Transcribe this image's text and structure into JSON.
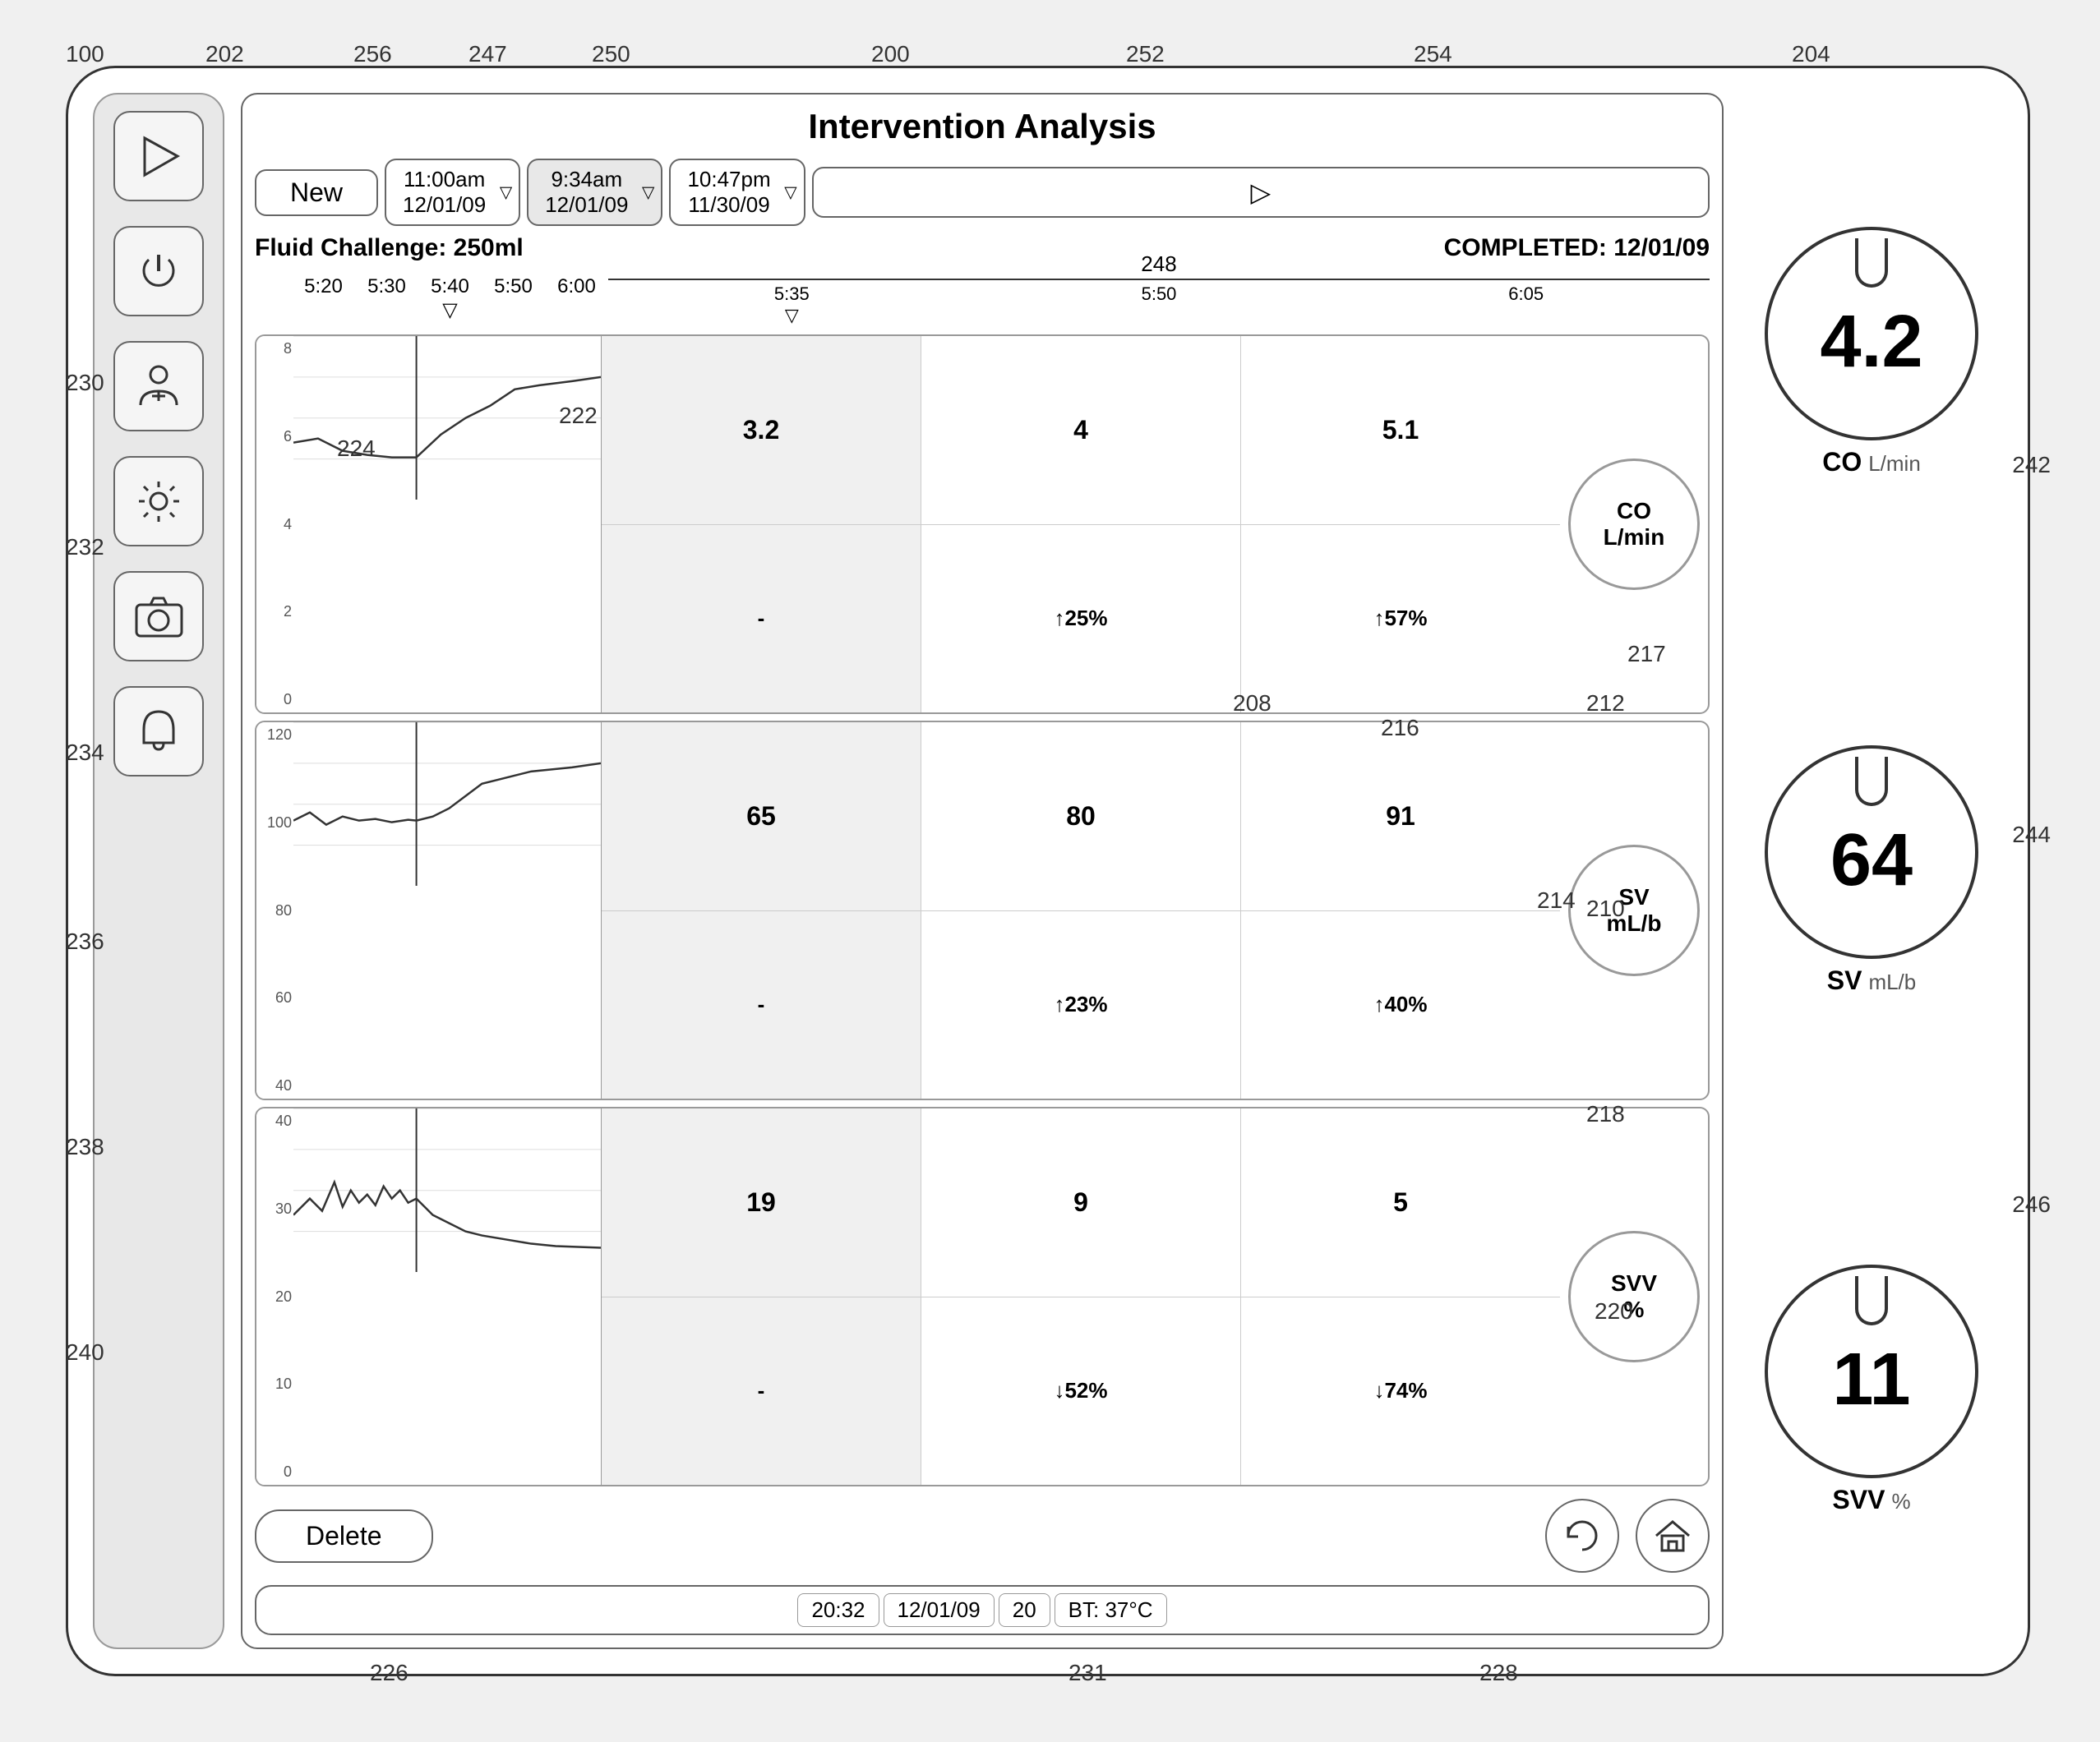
{
  "refs": {
    "r100": "100",
    "r200": "200",
    "r202": "202",
    "r204": "204",
    "r208": "208",
    "r210": "210",
    "r212": "212",
    "r214": "214",
    "r216": "216",
    "r217": "217",
    "r218": "218",
    "r220": "220",
    "r222": "222",
    "r224": "224",
    "r226": "226",
    "r228": "228",
    "r230": "230",
    "r231": "231",
    "r232": "232",
    "r234": "234",
    "r236": "236",
    "r238": "238",
    "r240": "240",
    "r242": "242",
    "r244": "244",
    "r246": "246",
    "r247": "247",
    "r248": "248",
    "r250": "250",
    "r252": "252",
    "r254": "254",
    "r256": "256"
  },
  "title": "Intervention Analysis",
  "tabs": {
    "new_label": "New",
    "tab1_time": "11:00am",
    "tab1_date": "12/01/09",
    "tab2_time": "9:34am",
    "tab2_date": "12/01/09",
    "tab3_time": "10:47pm",
    "tab3_date": "11/30/09"
  },
  "fluid_challenge": "Fluid Challenge: 250ml",
  "completed": "COMPLETED: 12/01/09",
  "time_labels": {
    "t1": "5:20",
    "t2": "5:30",
    "t3": "5:40",
    "t4": "5:50",
    "t5": "6:00",
    "t6": "5:35",
    "t7": "5:50",
    "t8": "6:05"
  },
  "co_row": {
    "label": "CO",
    "unit": "L/min",
    "val1": "3.2",
    "val2": "4",
    "val3": "5.1",
    "pct1": "-",
    "pct2": "↑25%",
    "pct3": "↑57%",
    "y_labels": [
      "8",
      "6",
      "4",
      "2",
      "0"
    ]
  },
  "sv_row": {
    "label": "SV",
    "unit": "mL/b",
    "val1": "65",
    "val2": "80",
    "val3": "91",
    "pct1": "-",
    "pct2": "↑23%",
    "pct3": "↑40%",
    "y_labels": [
      "120",
      "100",
      "80",
      "60",
      "40"
    ]
  },
  "svv_row": {
    "label": "SVV",
    "unit": "%",
    "val1": "19",
    "val2": "9",
    "val3": "5",
    "pct1": "-",
    "pct2": "↓52%",
    "pct3": "↓74%",
    "y_labels": [
      "40",
      "30",
      "20",
      "10",
      "0"
    ]
  },
  "knobs": {
    "co_value": "4.2",
    "co_label": "CO",
    "co_unit": "L/min",
    "sv_value": "64",
    "sv_label": "SV",
    "sv_unit": "mL/b",
    "svv_value": "11",
    "svv_label": "SVV",
    "svv_unit": "%"
  },
  "delete_label": "Delete",
  "status": {
    "time": "20:32",
    "date": "12/01/09",
    "num": "20",
    "bt": "BT: 37°C"
  }
}
